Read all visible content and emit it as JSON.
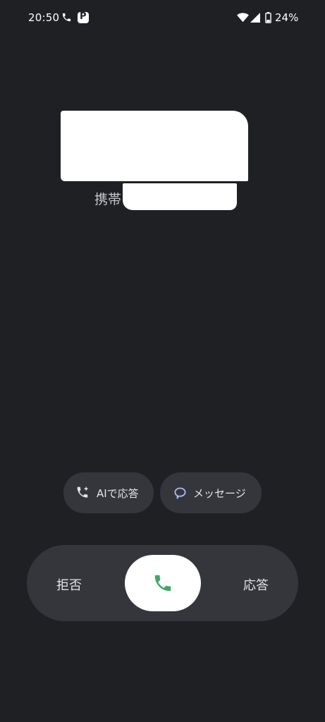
{
  "status_bar": {
    "time": "20:50",
    "battery": "24%",
    "icons": [
      "phone-call-icon",
      "paypay-icon",
      "wifi-icon",
      "signal-icon",
      "battery-icon"
    ],
    "paypay_glyph": "P"
  },
  "caller": {
    "type_label": "携帯"
  },
  "chips": {
    "ai_answer": "AIで応答",
    "message": "メッセージ"
  },
  "slider": {
    "decline": "拒否",
    "answer": "応答"
  },
  "colors": {
    "background": "#1f2024",
    "surface": "#35363b",
    "answer_green": "#3fa865",
    "message_icon": "#a9b8ff"
  }
}
